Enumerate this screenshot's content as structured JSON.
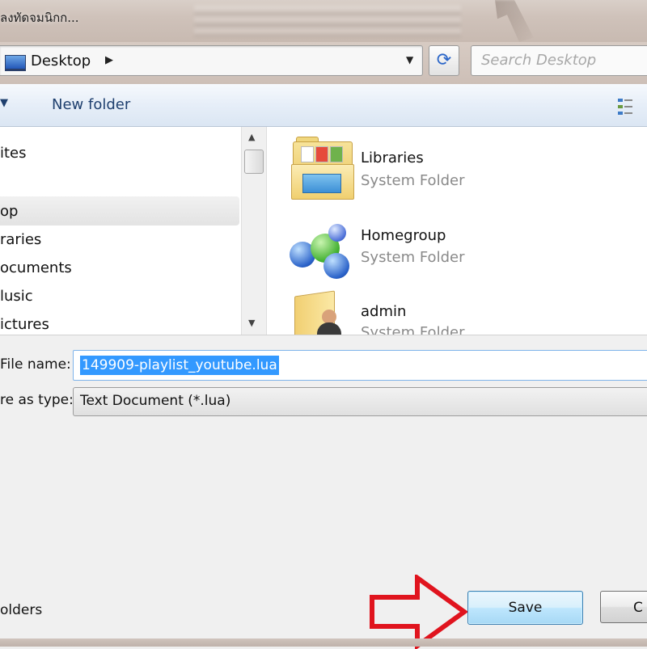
{
  "window": {
    "title": "ลงทัดจมนิกก..."
  },
  "address_bar": {
    "location": "Desktop",
    "separator": "▶",
    "dropdown": "▼",
    "refresh": "⟳"
  },
  "search": {
    "placeholder": "Search Desktop"
  },
  "toolbar": {
    "organize_label": "▼",
    "new_folder_label": "New folder"
  },
  "nav": {
    "items": [
      {
        "label": "ites"
      },
      {
        "label": "op",
        "selected": true
      },
      {
        "label": "raries"
      },
      {
        "label": "ocuments"
      },
      {
        "label": "lusic"
      },
      {
        "label": "ictures"
      }
    ],
    "scroll_up": "▲",
    "scroll_down": "▼"
  },
  "files": [
    {
      "name": "Libraries",
      "type": "System Folder",
      "icon": "libraries-icon"
    },
    {
      "name": "Homegroup",
      "type": "System Folder",
      "icon": "homegroup-icon"
    },
    {
      "name": "admin",
      "type": "System Folder",
      "icon": "user-folder-icon"
    }
  ],
  "form": {
    "file_name_label": "File name:",
    "file_name_value": "149909-playlist_youtube.lua",
    "save_type_label": "re as type:",
    "save_type_value": "Text Document (*.lua)"
  },
  "footer": {
    "hide_folders_label": "olders"
  },
  "buttons": {
    "save": "Save",
    "cancel": "C"
  },
  "colors": {
    "selection": "#3399ff",
    "annotation_arrow": "#e0141e",
    "toolbar_text": "#1e3f6e"
  }
}
